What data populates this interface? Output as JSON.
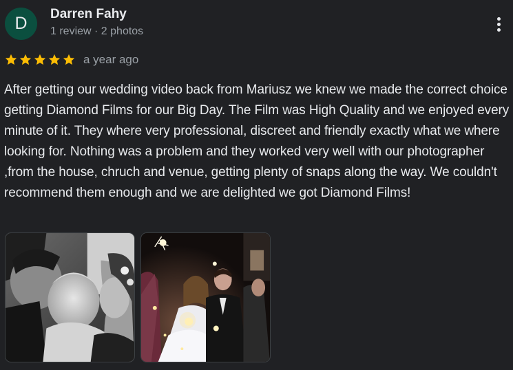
{
  "reviewer": {
    "avatar_letter": "D",
    "avatar_color": "#0b4f3f",
    "name": "Darren Fahy",
    "meta": "1 review · 2 photos"
  },
  "rating": {
    "stars": 5,
    "max": 5,
    "star_color": "#fbbc04",
    "date": "a year ago"
  },
  "review_text": "After getting our wedding video back from Mariusz we knew we made the correct choice getting Diamond Films for our Big Day. The Film was High Quality and we enjoyed every minute of it. They where very professional, discreet and friendly exactly what we where looking for. Nothing was a problem and they worked very well with our photographer ,from the house, chruch and venue, getting plenty of snaps along the way. We couldn't recommend them enough and we are delighted we got Diamond Films!",
  "more_menu": {
    "icon": "more-vert-icon"
  },
  "photos": [
    {
      "description_icon": "family-photo",
      "style": "black-and-white"
    },
    {
      "description_icon": "sparkler-exit-photo",
      "style": "color-night"
    }
  ]
}
